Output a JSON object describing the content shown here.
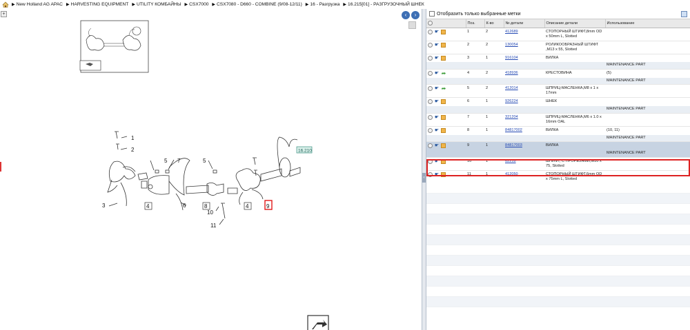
{
  "breadcrumb": [
    "New Holland AG APAC",
    "HARVESTING EQUIPMENT",
    "UTILITY КОМБАЙНЫ",
    "CSX7000",
    "CSX7080 - D660 - COMBINE (9/08-12/11)",
    "16 - Разгрузка",
    "16.215[01] - РАЗГРУЗОЧНЫЙ ШНЕК"
  ],
  "drawing": {
    "callout_ref": "16.210",
    "labels": [
      "1",
      "2",
      "3",
      "4",
      "5",
      "6",
      "7",
      "8",
      "9",
      "10",
      "11",
      "4",
      "5"
    ],
    "highlighted_label": "9"
  },
  "filter": {
    "label": "Отобразить только выбранные метки"
  },
  "table": {
    "headers": {
      "pos": "Поз.",
      "qty": "К-во",
      "part": "№ детали",
      "desc": "Описание детали",
      "usage": "Использование"
    },
    "rows": [
      {
        "pos": "1",
        "qty": "2",
        "part": "412689",
        "desc": "СТОПОРНЫЙ ШТИФТ,8mm OD x 50mm L, Slotted",
        "usage": "",
        "sub": "",
        "icon3": "box"
      },
      {
        "pos": "2",
        "qty": "2",
        "part": "130054",
        "desc": "РОЛИКООБРАЗНЫЙ ШТИФТ ,M13 x 55, Slotted",
        "usage": "",
        "sub": "",
        "icon3": "box"
      },
      {
        "pos": "3",
        "qty": "1",
        "part": "916104",
        "desc": "ВИЛКА",
        "usage": "",
        "sub": "MAINTENANCE PART",
        "icon3": "box"
      },
      {
        "pos": "4",
        "qty": "2",
        "part": "418936",
        "desc": "КРЕСТОВИНА",
        "usage": "(5)",
        "sub": "MAINTENANCE PART",
        "icon3": "leaf"
      },
      {
        "pos": "5",
        "qty": "2",
        "part": "412014",
        "desc": "ШПРИЦ-МАСЛЕНКА,M8 x 1 x 17mm",
        "usage": "",
        "sub": "",
        "icon3": "leaf"
      },
      {
        "pos": "6",
        "qty": "1",
        "part": "926224",
        "desc": "ШНЕК",
        "usage": "",
        "sub": "MAINTENANCE PART",
        "icon3": "box"
      },
      {
        "pos": "7",
        "qty": "1",
        "part": "321204",
        "desc": "ШПРИЦ-МАСЛЕНКА,M6 x 1.0 x 16mm OAL",
        "usage": "",
        "sub": "",
        "icon3": "box"
      },
      {
        "pos": "8",
        "qty": "1",
        "part": "84817002",
        "desc": "ВИЛКА",
        "usage": "(10, 11)",
        "sub": "MAINTENANCE PART",
        "icon3": "box"
      },
      {
        "pos": "9",
        "qty": "1",
        "part": "84817003",
        "desc": "ВИЛКА",
        "usage": "",
        "sub": "MAINTENANCE PART",
        "icon3": "box",
        "selected": true
      },
      {
        "pos": "10",
        "qty": "1",
        "part": "62218",
        "desc": "ШПИФТ, С ПРОРЕЗЯМИ,M10 x 75, Slotted",
        "usage": "",
        "sub": "",
        "icon3": "box"
      },
      {
        "pos": "11",
        "qty": "1",
        "part": "412050",
        "desc": "СТОПОРНЫЙ ШТИФТ,6mm OD x 75mm L, Slotted",
        "usage": "",
        "sub": "",
        "icon3": "box"
      }
    ]
  },
  "colors": {
    "accent": "#3d6fb4",
    "selection": "#c7d3e2",
    "highlight": "#d22222",
    "link": "#2348b3"
  }
}
